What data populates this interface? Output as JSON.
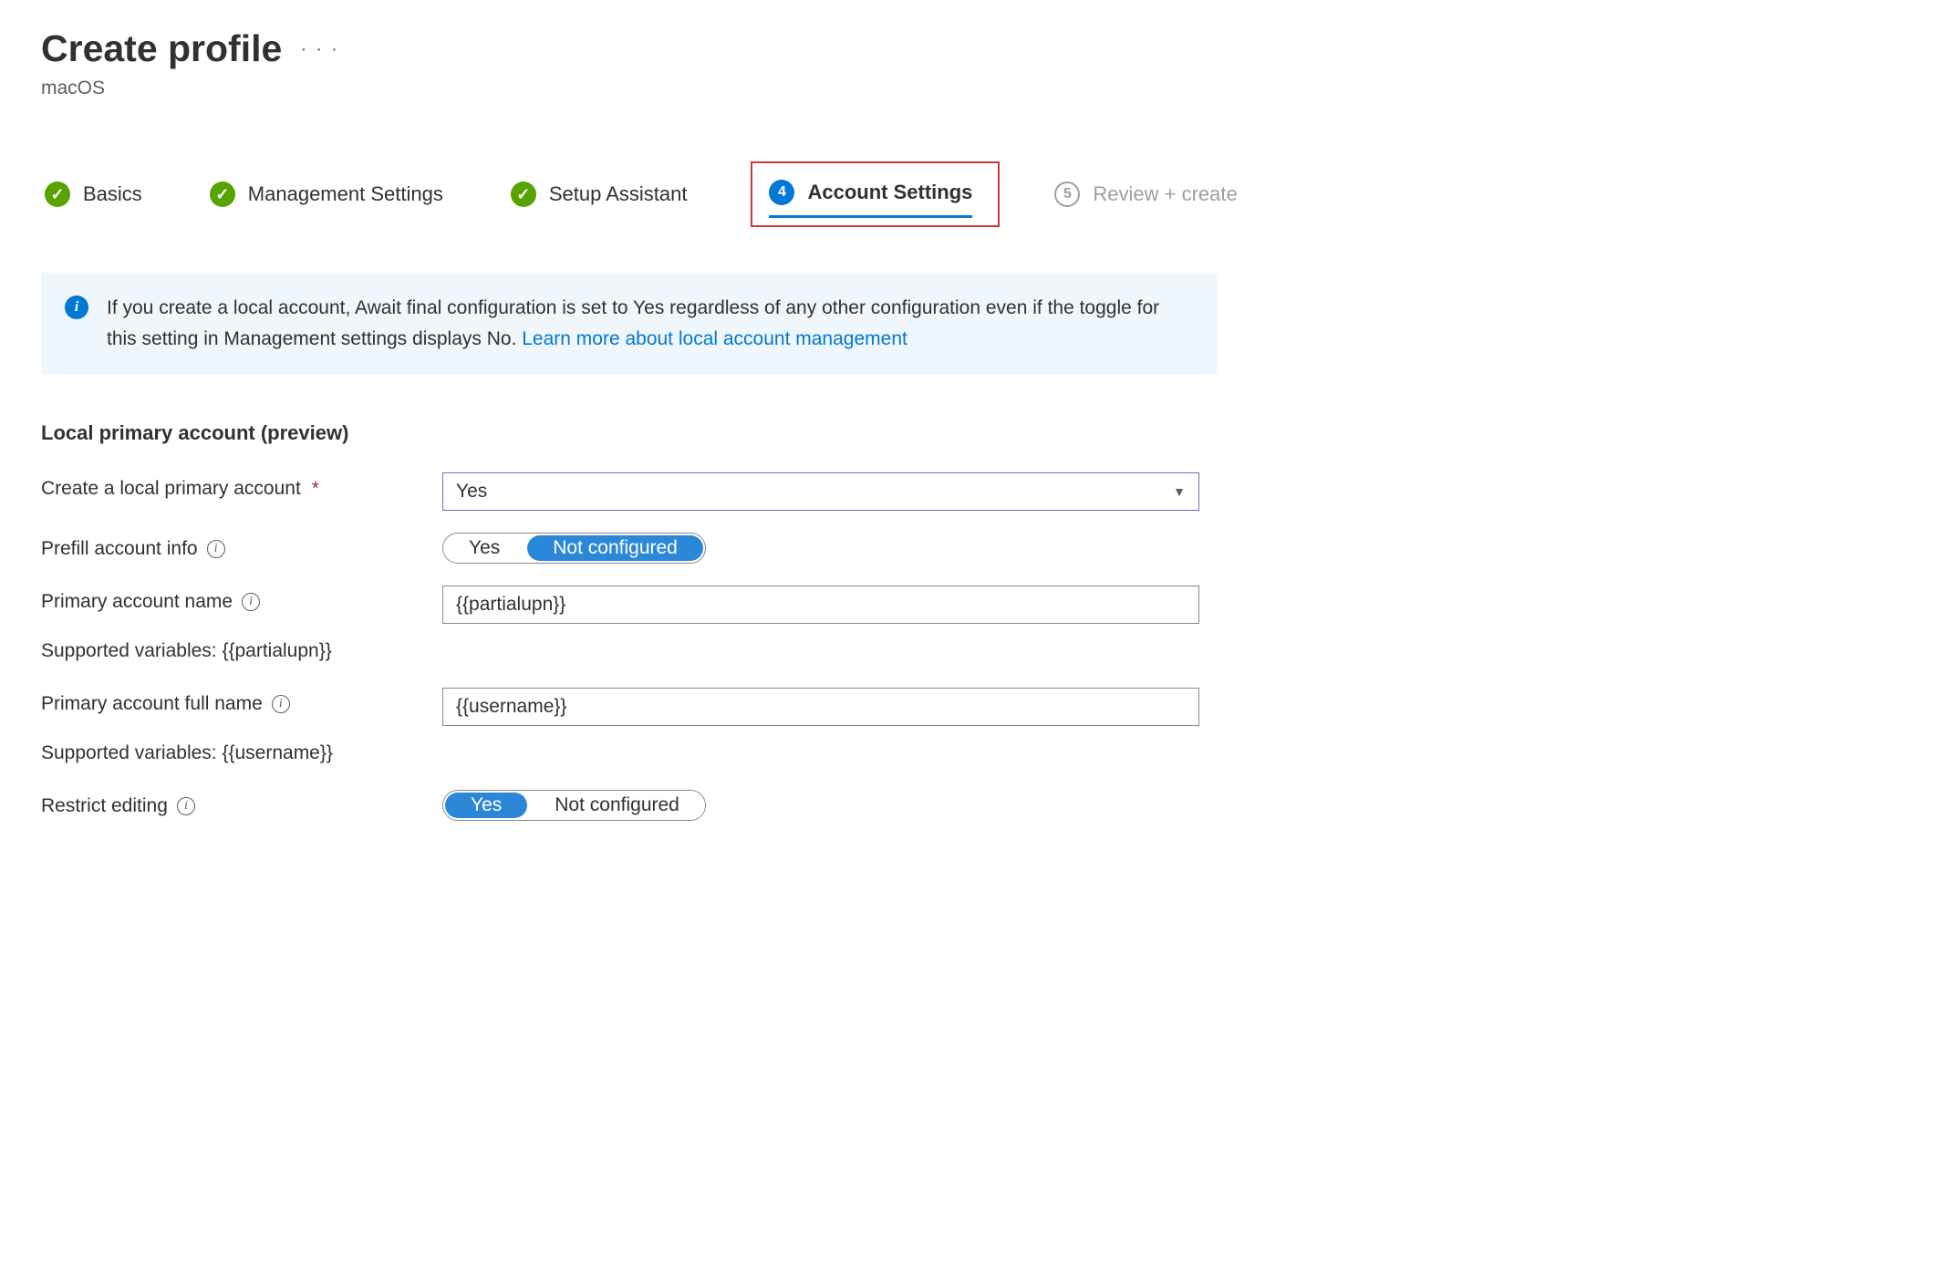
{
  "header": {
    "title": "Create profile",
    "subtitle": "macOS"
  },
  "stepper": {
    "step1": "Basics",
    "step2": "Management Settings",
    "step3": "Setup Assistant",
    "step4_num": "4",
    "step4": "Account Settings",
    "step5_num": "5",
    "step5": "Review + create"
  },
  "banner": {
    "text": "If you create a local account, Await final configuration is set to Yes regardless of any other configuration even if the toggle for this setting in Management settings displays No. ",
    "link": "Learn more about local account management"
  },
  "section": {
    "heading": "Local primary account (preview)"
  },
  "fields": {
    "create_local": {
      "label": "Create a local primary account",
      "value": "Yes"
    },
    "prefill": {
      "label": "Prefill account info",
      "yes": "Yes",
      "not": "Not configured"
    },
    "primary_name": {
      "label": "Primary account name",
      "value": "{{partialupn}}",
      "supported": "Supported variables: {{partialupn}}"
    },
    "primary_full": {
      "label": "Primary account full name",
      "value": "{{username}}",
      "supported": "Supported variables: {{username}}"
    },
    "restrict": {
      "label": "Restrict editing",
      "yes": "Yes",
      "not": "Not configured"
    }
  }
}
